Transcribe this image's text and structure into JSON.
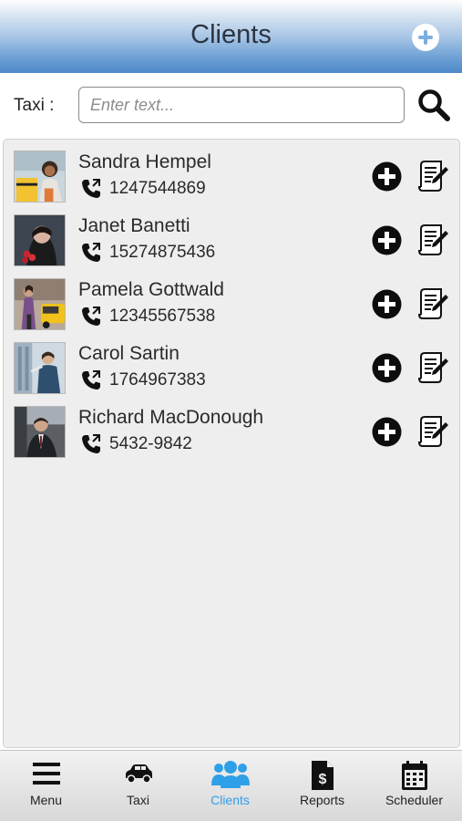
{
  "header": {
    "title": "Clients"
  },
  "search": {
    "label": "Taxi :",
    "placeholder": "Enter text...",
    "value": ""
  },
  "clients": [
    {
      "name": "Sandra Hempel",
      "phone": "1247544869"
    },
    {
      "name": "Janet Banetti",
      "phone": "15274875436"
    },
    {
      "name": "Pamela Gottwald",
      "phone": "12345567538"
    },
    {
      "name": "Carol Sartin",
      "phone": "1764967383"
    },
    {
      "name": "Richard MacDonough",
      "phone": "5432-9842"
    }
  ],
  "tabs": [
    {
      "label": "Menu",
      "icon": "menu-icon"
    },
    {
      "label": "Taxi",
      "icon": "car-icon"
    },
    {
      "label": "Clients",
      "icon": "users-icon",
      "active": true
    },
    {
      "label": "Reports",
      "icon": "report-icon"
    },
    {
      "label": "Scheduler",
      "icon": "calendar-icon"
    }
  ],
  "colors": {
    "accent": "#2f9fe8",
    "header_top": "#ffffff",
    "header_bottom": "#4e89c8"
  }
}
